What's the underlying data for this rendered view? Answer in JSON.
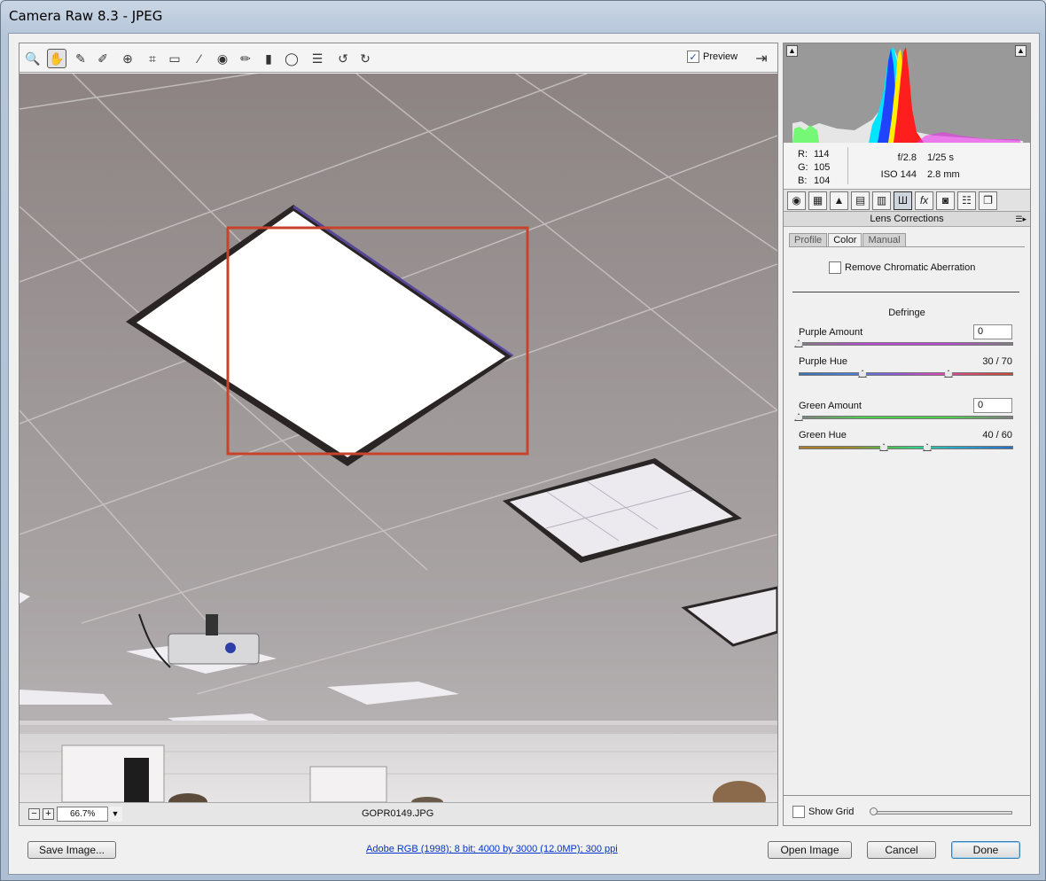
{
  "window": {
    "title": "Camera Raw 8.3  -  JPEG"
  },
  "toolbar": {
    "tools": [
      {
        "name": "zoom-tool-icon",
        "glyph": "🔍"
      },
      {
        "name": "hand-tool-icon",
        "glyph": "✋"
      },
      {
        "name": "white-balance-tool-icon",
        "glyph": "✎"
      },
      {
        "name": "color-sampler-tool-icon",
        "glyph": "✐"
      },
      {
        "name": "targeted-adjustment-tool-icon",
        "glyph": "⊕"
      },
      {
        "name": "crop-tool-icon",
        "glyph": "⌗"
      },
      {
        "name": "straighten-tool-icon",
        "glyph": "▭"
      },
      {
        "name": "spot-removal-tool-icon",
        "glyph": "⁄"
      },
      {
        "name": "red-eye-removal-tool-icon",
        "glyph": "◉"
      },
      {
        "name": "adjustment-brush-icon",
        "glyph": "✏"
      },
      {
        "name": "graduated-filter-icon",
        "glyph": "▮"
      },
      {
        "name": "radial-filter-icon",
        "glyph": "◯"
      },
      {
        "name": "preferences-icon",
        "glyph": "☰"
      },
      {
        "name": "rotate-ccw-icon",
        "glyph": "↺"
      },
      {
        "name": "rotate-cw-icon",
        "glyph": "↻"
      }
    ],
    "preview_label": "Preview",
    "preview_checked": "✓",
    "fullscreen_glyph": "⇥"
  },
  "status": {
    "zoom_minus": "−",
    "zoom_plus": "+",
    "zoom_value": "66.7%",
    "zoom_arrow": "▼",
    "filename": "GOPR0149.JPG"
  },
  "readout": {
    "r_label": "R:",
    "r_value": "114",
    "g_label": "G:",
    "g_value": "105",
    "b_label": "B:",
    "b_value": "104",
    "aperture": "f/2.8",
    "shutter": "1/25 s",
    "iso": "ISO 144",
    "focal": "2.8 mm"
  },
  "panel": {
    "tabs": [
      "◉",
      "▦",
      "▲",
      "▤",
      "▥",
      "Ш",
      "fx",
      "◙",
      "☷",
      "❐"
    ],
    "title": "Lens Corrections",
    "menu_glyph": "☰▸",
    "subtabs": [
      "Profile",
      "Color",
      "Manual"
    ],
    "remove_ca_label": "Remove Chromatic Aberration",
    "defringe_heading": "Defringe",
    "purple_amount_label": "Purple Amount",
    "purple_amount_value": "0",
    "purple_hue_label": "Purple Hue",
    "purple_hue_value": "30 / 70",
    "green_amount_label": "Green Amount",
    "green_amount_value": "0",
    "green_hue_label": "Green Hue",
    "green_hue_value": "40 / 60",
    "show_grid_label": "Show Grid"
  },
  "buttons": {
    "save": "Save Image...",
    "info_link": "Adobe RGB (1998); 8 bit; 4000 by 3000 (12.0MP); 300 ppi",
    "open": "Open Image",
    "cancel": "Cancel",
    "done": "Done"
  },
  "colors": {
    "selection_box": "#c8432b",
    "link": "#0033cc"
  }
}
